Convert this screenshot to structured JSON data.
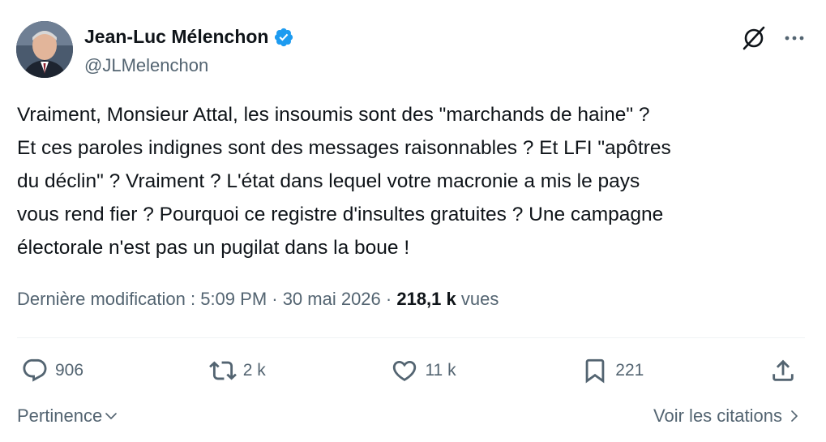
{
  "author": {
    "display_name": "Jean-Luc Mélenchon",
    "handle": "@JLMelenchon",
    "verified": true,
    "verified_color": "#1d9bf0"
  },
  "tweet": {
    "text": "Vraiment, Monsieur Attal, les insoumis sont des \"marchands de haine\" ?\nEt ces paroles indignes sont des messages raisonnables ? Et LFI \"apôtres\ndu déclin\" ? Vraiment ? L'état dans lequel votre macronie a mis le pays\nvous rend fier ? Pourquoi ce registre d'insultes gratuites ? Une campagne\nélectorale n'est pas un pugilat dans la boue !",
    "edited_label": "Dernière modification : 5:09 PM · 30 mai 2026 ·",
    "views_count": "218,1 k",
    "views_label": "vues"
  },
  "actions": {
    "replies": "906",
    "reposts": "2 k",
    "likes": "11 k",
    "bookmarks": "221"
  },
  "footer": {
    "sort_label": "Pertinence",
    "quotes_label": "Voir les citations"
  },
  "icons": {
    "grok": "grok-icon",
    "more": "more-icon",
    "reply": "reply-icon",
    "repost": "repost-icon",
    "like": "heart-icon",
    "bookmark": "bookmark-icon",
    "share": "share-icon"
  },
  "colors": {
    "text_primary": "#0f1419",
    "text_secondary": "#536471",
    "divider": "#eff3f4"
  }
}
